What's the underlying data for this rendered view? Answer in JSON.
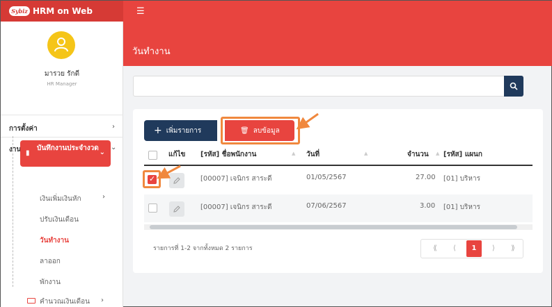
{
  "app": {
    "logo_text": "Sybiz",
    "title": "HRM on Web",
    "menu_icon": "hamburger-icon"
  },
  "user": {
    "name": "มารวย รักดี",
    "role": "HR Manager"
  },
  "sidebar": {
    "settings_label": "การตั้งค่า",
    "payroll_label": "งานเงินเดือน",
    "active_group_label": "บันทึกงานประจำงวด",
    "sub_items": [
      "เงินเพิ่มเงินหัก",
      "ปรับเงินเดือน",
      "วันทำงาน",
      "ลาออก",
      "พักงาน"
    ],
    "calc_label": "คำนวณเงินเดือน"
  },
  "page": {
    "title": "วันทำงาน",
    "search_placeholder": ""
  },
  "toolbar": {
    "add_label": "เพิ่มรายการ",
    "delete_label": "ลบข้อมูล"
  },
  "table": {
    "columns": [
      "แก้ไข",
      "[รหัส] ชื่อพนักงาน",
      "วันที่",
      "จำนวน",
      "[รหัส] แผนก"
    ],
    "rows": [
      {
        "employee": "[00007] เจนิกร สาระดี",
        "date": "01/05/2567",
        "amount": "27.00",
        "dept": "[01] บริหาร",
        "checked": true
      },
      {
        "employee": "[00007] เจนิกร สาระดี",
        "date": "07/06/2567",
        "amount": "3.00",
        "dept": "[01] บริหาร",
        "checked": false
      }
    ]
  },
  "footer": {
    "info": "รายการที่ 1-2 จากทั้งหมด 2 รายการ"
  },
  "pagination": {
    "first": "⟪",
    "prev": "⟨",
    "current": "1",
    "next": "⟩",
    "last": "⟫"
  },
  "colors": {
    "primary_red": "#e8443f",
    "navy": "#203a5c",
    "highlight_orange": "#f0883e",
    "avatar_yellow": "#f5c518"
  }
}
